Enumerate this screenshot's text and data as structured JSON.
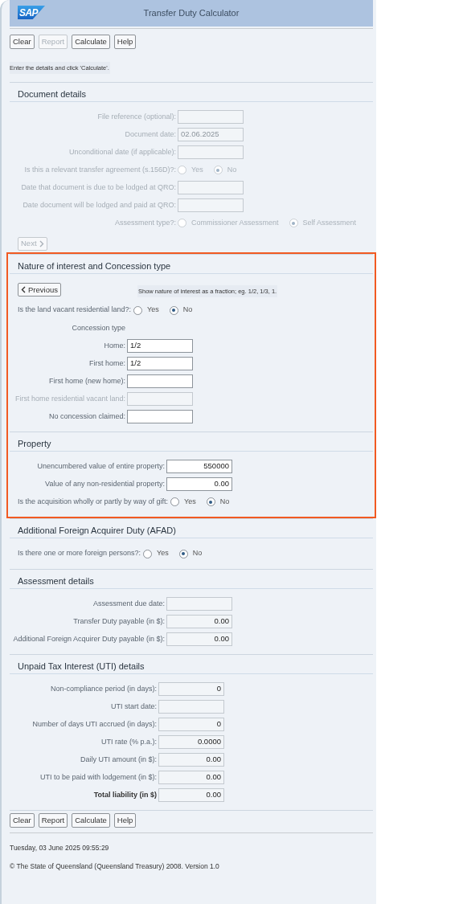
{
  "header": {
    "logo_text": "SAP",
    "title": "Transfer Duty Calculator"
  },
  "top_toolbar": [
    {
      "label": "Clear",
      "disabled": false
    },
    {
      "label": "Report",
      "disabled": true
    },
    {
      "label": "Calculate",
      "disabled": false
    },
    {
      "label": "Help",
      "disabled": false
    }
  ],
  "message": "Enter the details and click 'Calculate'.",
  "sections": [
    {
      "title": "Document details",
      "highlighted": false,
      "rows": [
        {
          "kind": "field",
          "label": "File reference (optional):",
          "disabled": true,
          "editable": false
        },
        {
          "kind": "field",
          "label": "Document date:",
          "value": "02.06.2025",
          "disabled": true,
          "editable": false
        },
        {
          "kind": "field",
          "label": "Unconditional date (if applicable):",
          "disabled": true,
          "editable": false
        },
        {
          "kind": "radio",
          "label": "Is this a relevant transfer agreement (s.156D)?:",
          "disabled": true,
          "options": [
            {
              "label": "Yes",
              "selected": false
            },
            {
              "label": "No",
              "selected": true
            }
          ]
        },
        {
          "kind": "field",
          "label": "Date that document is due to be lodged at QRO:",
          "disabled": true,
          "editable": false
        },
        {
          "kind": "field",
          "label": "Date document will be lodged and paid at QRO:",
          "disabled": true,
          "editable": false
        },
        {
          "kind": "radio",
          "label": "Assessment type?:",
          "disabled": true,
          "options": [
            {
              "label": "Commissioner Assessment",
              "selected": false
            },
            {
              "label": "Self Assessment",
              "selected": true
            }
          ]
        }
      ],
      "footer_button": {
        "label": "Next",
        "disabled": true
      }
    },
    {
      "title": "Nature of interest and Concession type",
      "highlighted": true,
      "header_button": {
        "label": "Previous",
        "disabled": false
      },
      "hint": "Show nature of interest as a fraction; eg. 1/2, 1/3, 1.",
      "rows": [
        {
          "kind": "radio-inline",
          "label": "Is the land vacant residential land?:",
          "disabled": false,
          "options": [
            {
              "label": "Yes",
              "selected": false
            },
            {
              "label": "No",
              "selected": true
            }
          ]
        },
        {
          "kind": "caption",
          "label": "Concession type",
          "disabled": false
        },
        {
          "kind": "field",
          "label": "Home:",
          "value": "1/2",
          "disabled": false,
          "editable": true
        },
        {
          "kind": "field",
          "label": "First home:",
          "value": "1/2",
          "disabled": false,
          "editable": true
        },
        {
          "kind": "field",
          "label": "First home (new home):",
          "disabled": false,
          "editable": true
        },
        {
          "kind": "field",
          "label": "First home residential vacant land:",
          "disabled": true,
          "editable": false
        },
        {
          "kind": "field",
          "label": "No concession claimed:",
          "disabled": false,
          "editable": true
        }
      ]
    },
    {
      "title": "Property",
      "highlighted": true,
      "rows": [
        {
          "kind": "field",
          "label": "Unencumbered value of entire property:",
          "value": "550000",
          "numeric": true,
          "disabled": false,
          "editable": true
        },
        {
          "kind": "field",
          "label": "Value of any non-residential property:",
          "value": "0.00",
          "numeric": true,
          "disabled": false,
          "editable": true
        },
        {
          "kind": "radio-inline",
          "label": "Is the acquisition wholly or partly by way of gift:",
          "disabled": false,
          "options": [
            {
              "label": "Yes",
              "selected": false
            },
            {
              "label": "No",
              "selected": true
            }
          ]
        }
      ]
    },
    {
      "title": "Additional Foreign Acquirer Duty (AFAD)",
      "highlighted": false,
      "rows": [
        {
          "kind": "radio-inline",
          "label": "Is there one or more foreign persons?:",
          "disabled": false,
          "options": [
            {
              "label": "Yes",
              "selected": false
            },
            {
              "label": "No",
              "selected": true
            }
          ]
        }
      ]
    },
    {
      "title": "Assessment details",
      "highlighted": false,
      "rows": [
        {
          "kind": "field",
          "label": "Assessment due date:",
          "disabled": false,
          "editable": false
        },
        {
          "kind": "field",
          "label": "Transfer Duty payable (in $):",
          "value": "0.00",
          "numeric": true,
          "disabled": false,
          "editable": false
        },
        {
          "kind": "field",
          "label": "Additional Foreign Acquirer Duty payable (in $):",
          "value": "0.00",
          "numeric": true,
          "disabled": false,
          "editable": false
        }
      ]
    },
    {
      "title": "Unpaid Tax Interest (UTI) details",
      "highlighted": false,
      "rows": [
        {
          "kind": "field",
          "label": "Non-compliance period (in days):",
          "value": "0",
          "numeric": true,
          "disabled": false,
          "editable": false
        },
        {
          "kind": "field",
          "label": "UTI start date:",
          "disabled": false,
          "editable": false
        },
        {
          "kind": "field",
          "label": "Number of days UTI accrued (in days):",
          "value": "0",
          "numeric": true,
          "disabled": false,
          "editable": false
        },
        {
          "kind": "field",
          "label": "UTI rate (% p.a.):",
          "value": "0.0000",
          "numeric": true,
          "disabled": false,
          "editable": false
        },
        {
          "kind": "field",
          "label": "Daily UTI amount (in $):",
          "value": "0.00",
          "numeric": true,
          "disabled": false,
          "editable": false
        },
        {
          "kind": "field",
          "label": "UTI to be paid with lodgement (in $):",
          "value": "0.00",
          "numeric": true,
          "disabled": false,
          "editable": false
        },
        {
          "kind": "field",
          "label": "Total liability (in $)",
          "value": "0.00",
          "numeric": true,
          "bold": true,
          "disabled": false,
          "editable": false
        }
      ]
    }
  ],
  "bottom_toolbar": [
    {
      "label": "Clear",
      "disabled": false
    },
    {
      "label": "Report",
      "disabled": false
    },
    {
      "label": "Calculate",
      "disabled": false
    },
    {
      "label": "Help",
      "disabled": false
    }
  ],
  "timestamp": "Tuesday, 03 June 2025 09:55:29",
  "copyright": "© The State of Queensland (Queensland Treasury) 2008. Version 1.0"
}
